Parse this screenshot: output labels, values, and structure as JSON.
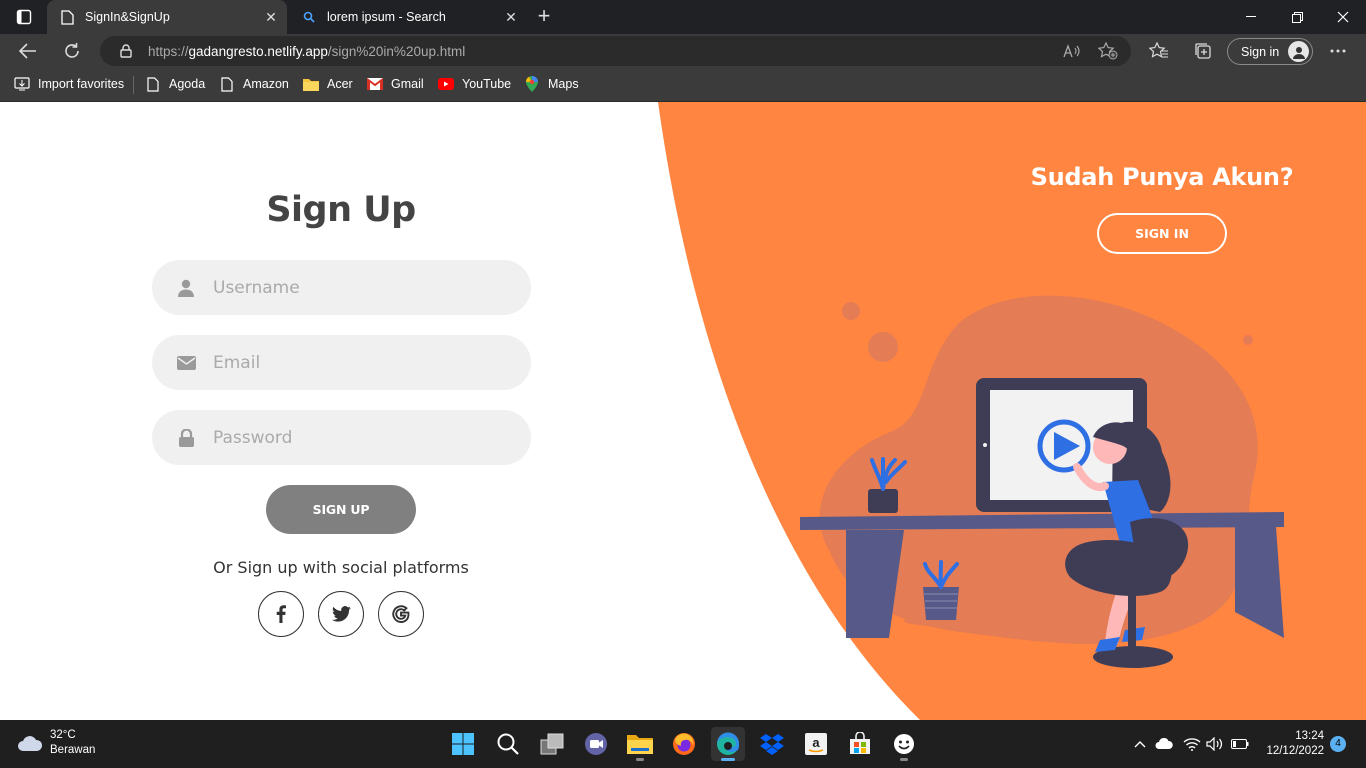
{
  "browser": {
    "tabs": [
      {
        "title": "SignIn&SignUp",
        "active": true
      },
      {
        "title": "lorem ipsum - Search",
        "active": false
      }
    ],
    "url_prefix": "https://",
    "url_host": "gadangresto.netlify.app",
    "url_path": "/sign%20in%20up.html",
    "signin_label": "Sign in",
    "favorites": [
      {
        "label": "Import favorites",
        "icon": "import-favorites-icon"
      },
      {
        "label": "Agoda",
        "icon": "page-icon"
      },
      {
        "label": "Amazon",
        "icon": "page-icon"
      },
      {
        "label": "Acer",
        "icon": "folder-icon"
      },
      {
        "label": "Gmail",
        "icon": "gmail-icon"
      },
      {
        "label": "YouTube",
        "icon": "youtube-icon"
      },
      {
        "label": "Maps",
        "icon": "maps-icon"
      }
    ]
  },
  "form": {
    "title": "Sign Up",
    "username_placeholder": "Username",
    "email_placeholder": "Email",
    "password_placeholder": "Password",
    "submit_label": "SIGN UP",
    "social_text": "Or Sign up with social platforms",
    "social": [
      "facebook-icon",
      "twitter-icon",
      "google-icon"
    ]
  },
  "panel": {
    "question": "Sudah Punya Akun?",
    "signin_button": "SIGN IN"
  },
  "colors": {
    "accent": "#ff8540",
    "button_gray": "#808080",
    "field_bg": "#f0f0f0",
    "heading": "#444444"
  },
  "taskbar": {
    "temperature": "32°C",
    "weather_text": "Berawan",
    "time": "13:24",
    "date": "12/12/2022",
    "notification_count": "4",
    "apps": [
      "start-icon",
      "search-icon",
      "task-view-icon",
      "chat-icon",
      "file-explorer-icon",
      "firefox-icon",
      "edge-icon",
      "dropbox-icon",
      "amazon-icon",
      "store-icon",
      "emoji-icon"
    ]
  }
}
